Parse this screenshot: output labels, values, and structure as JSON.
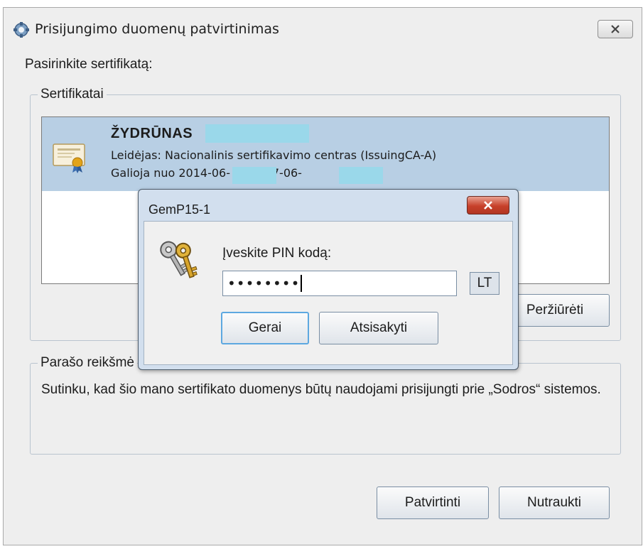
{
  "window": {
    "title": "Prisijungimo duomenų patvirtinimas"
  },
  "prompt": "Pasirinkite sertifikatą:",
  "certificates": {
    "legend": "Sertifikatai",
    "items": [
      {
        "name": "ŽYDRŪNAS",
        "issuer": "Leidėjas: Nacionalinis sertifikavimo centras (IssuingCA-A)",
        "validity": "Galioja nuo 2014-06-     iki 2017-06-"
      }
    ],
    "view_button": "Peržiūrėti"
  },
  "signature": {
    "legend": "Parašo reikšmė",
    "text": "Sutinku, kad šio mano sertifikato duomenys būtų naudojami prisijungti prie „Sodros“ sistemos."
  },
  "buttons": {
    "confirm": "Patvirtinti",
    "abort": "Nutraukti"
  },
  "pin_dialog": {
    "title": "GemP15-1",
    "label": "Įveskite PIN kodą:",
    "pin_value": "••••••••",
    "language": "LT",
    "ok": "Gerai",
    "cancel": "Atsisakyti"
  },
  "colors": {
    "selection": "#b8cfe4",
    "redaction": "#9ad8ea",
    "dialog_frame": "#d2dfee",
    "close_red": "#c7402a"
  }
}
